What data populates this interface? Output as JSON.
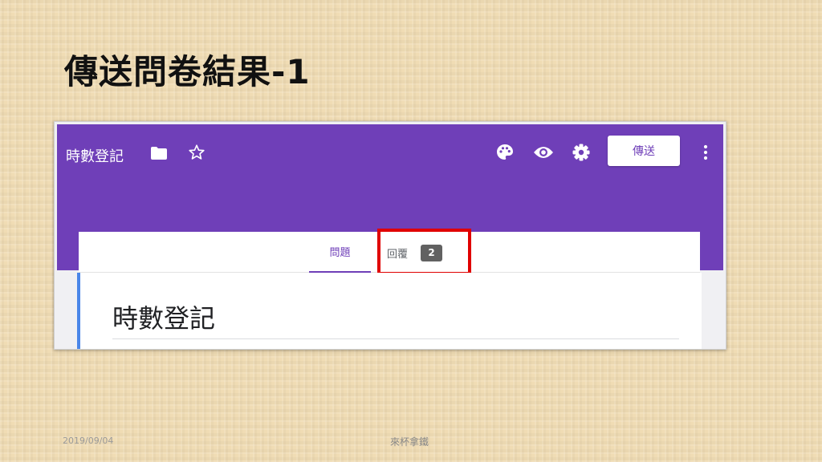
{
  "slide": {
    "title": "傳送問卷結果-1",
    "footer_date": "2019/09/04",
    "footer_center": "來杯拿鐵"
  },
  "forms_header": {
    "form_name": "時數登記",
    "icons": [
      "folder-icon",
      "star-icon",
      "palette-icon",
      "eye-icon",
      "gear-icon",
      "more-vert-icon"
    ],
    "send_label": "傳送",
    "accent_color": "#6f3fb8"
  },
  "tabs": {
    "questions_label": "問題",
    "responses_label": "回覆",
    "responses_count": "2",
    "highlight_color": "#e00000"
  },
  "form_card": {
    "title": "時數登記",
    "accent_color": "#4a86e8"
  }
}
